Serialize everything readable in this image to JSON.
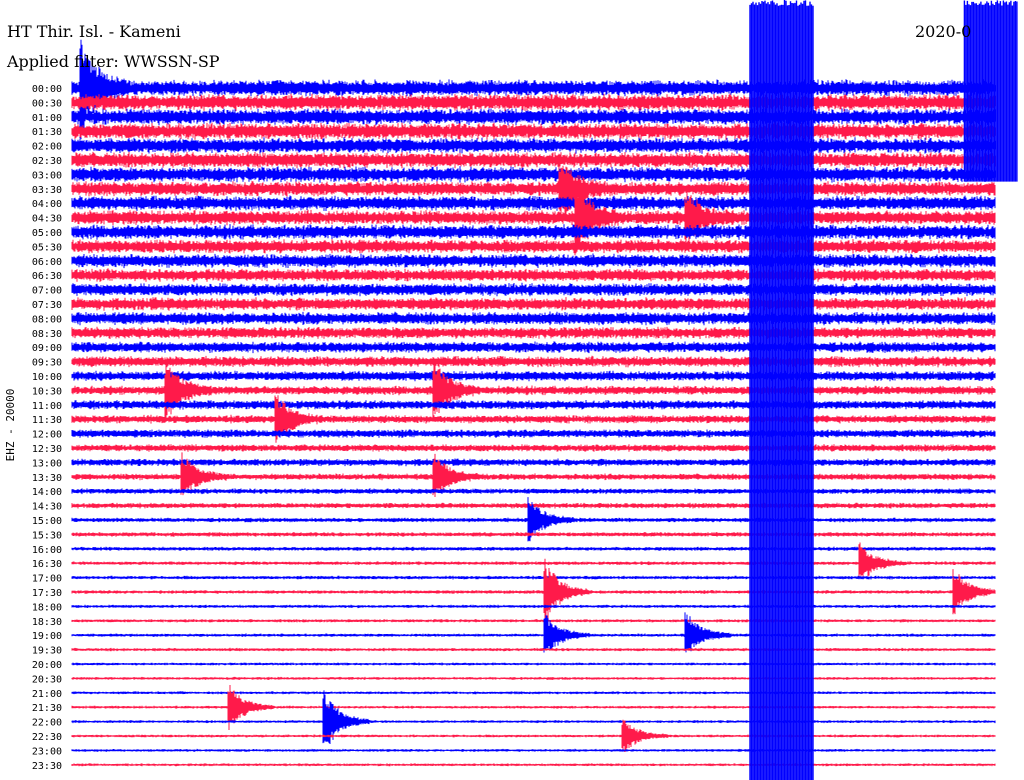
{
  "header": {
    "station": "HT Thir. Isl. - Kameni",
    "filter": "Applied filter: WWSSN-SP",
    "date": "2020-0"
  },
  "chart_data": {
    "type": "line",
    "title": "HT Thir. Isl. - Kameni",
    "subtitle": "Applied filter: WWSSN-SP",
    "ylabel": "EHZ - 20000",
    "x_unit": "minutes within 30-minute row",
    "xlim": [
      0,
      30
    ],
    "row_labels": [
      "00:00",
      "00:30",
      "01:00",
      "01:30",
      "02:00",
      "02:30",
      "03:00",
      "03:30",
      "04:00",
      "04:30",
      "05:00",
      "05:30",
      "06:00",
      "06:30",
      "07:00",
      "07:30",
      "08:00",
      "08:30",
      "09:00",
      "09:30",
      "10:00",
      "10:30",
      "11:00",
      "11:30",
      "12:00",
      "12:30",
      "13:00",
      "13:30",
      "14:00",
      "14:30",
      "15:00",
      "15:30",
      "16:00",
      "16:30",
      "17:00",
      "17:30",
      "18:00",
      "18:30",
      "19:00",
      "19:30",
      "20:00",
      "20:30",
      "21:00",
      "21:30",
      "22:00",
      "22:30",
      "23:00",
      "23:30"
    ],
    "series_colors": {
      "even_rows": "#0000ff",
      "odd_rows": "#ff1a4a"
    },
    "trace_end_minute": 29.3,
    "saturation_bands": [
      {
        "start_minute": 21.5,
        "end_minute": 23.5,
        "color": "#0000ff"
      },
      {
        "start_minute": 28.3,
        "end_minute": 30.0,
        "color": "#0000ff",
        "rows_from": "00:00",
        "rows_to": "03:00"
      }
    ],
    "noise_level_by_row": [
      0.9,
      0.9,
      0.9,
      0.9,
      0.85,
      0.85,
      0.85,
      0.8,
      0.8,
      0.8,
      0.8,
      0.75,
      0.75,
      0.7,
      0.7,
      0.7,
      0.7,
      0.65,
      0.6,
      0.6,
      0.55,
      0.5,
      0.5,
      0.45,
      0.45,
      0.4,
      0.4,
      0.35,
      0.3,
      0.3,
      0.25,
      0.25,
      0.22,
      0.2,
      0.2,
      0.2,
      0.18,
      0.18,
      0.18,
      0.18,
      0.16,
      0.16,
      0.16,
      0.16,
      0.16,
      0.16,
      0.16,
      0.16
    ],
    "events": [
      {
        "row": "00:00",
        "minute": 0.3,
        "amplitude": 4.0
      },
      {
        "row": "03:30",
        "minute": 15.5,
        "amplitude": 2.5
      },
      {
        "row": "04:30",
        "minute": 16.0,
        "amplitude": 3.0
      },
      {
        "row": "04:30",
        "minute": 19.5,
        "amplitude": 2.0
      },
      {
        "row": "10:30",
        "minute": 3.0,
        "amplitude": 2.5
      },
      {
        "row": "10:30",
        "minute": 11.5,
        "amplitude": 2.5
      },
      {
        "row": "11:30",
        "minute": 6.5,
        "amplitude": 2.0
      },
      {
        "row": "13:30",
        "minute": 3.5,
        "amplitude": 2.0
      },
      {
        "row": "13:30",
        "minute": 11.5,
        "amplitude": 2.0
      },
      {
        "row": "15:00",
        "minute": 14.5,
        "amplitude": 2.0
      },
      {
        "row": "16:30",
        "minute": 25.0,
        "amplitude": 1.8
      },
      {
        "row": "17:30",
        "minute": 15.0,
        "amplitude": 3.0
      },
      {
        "row": "17:30",
        "minute": 28.0,
        "amplitude": 2.0
      },
      {
        "row": "19:00",
        "minute": 15.0,
        "amplitude": 2.0
      },
      {
        "row": "19:00",
        "minute": 19.5,
        "amplitude": 2.0
      },
      {
        "row": "21:30",
        "minute": 5.0,
        "amplitude": 2.0
      },
      {
        "row": "22:00",
        "minute": 8.0,
        "amplitude": 3.0
      },
      {
        "row": "22:30",
        "minute": 17.5,
        "amplitude": 1.5
      }
    ]
  }
}
